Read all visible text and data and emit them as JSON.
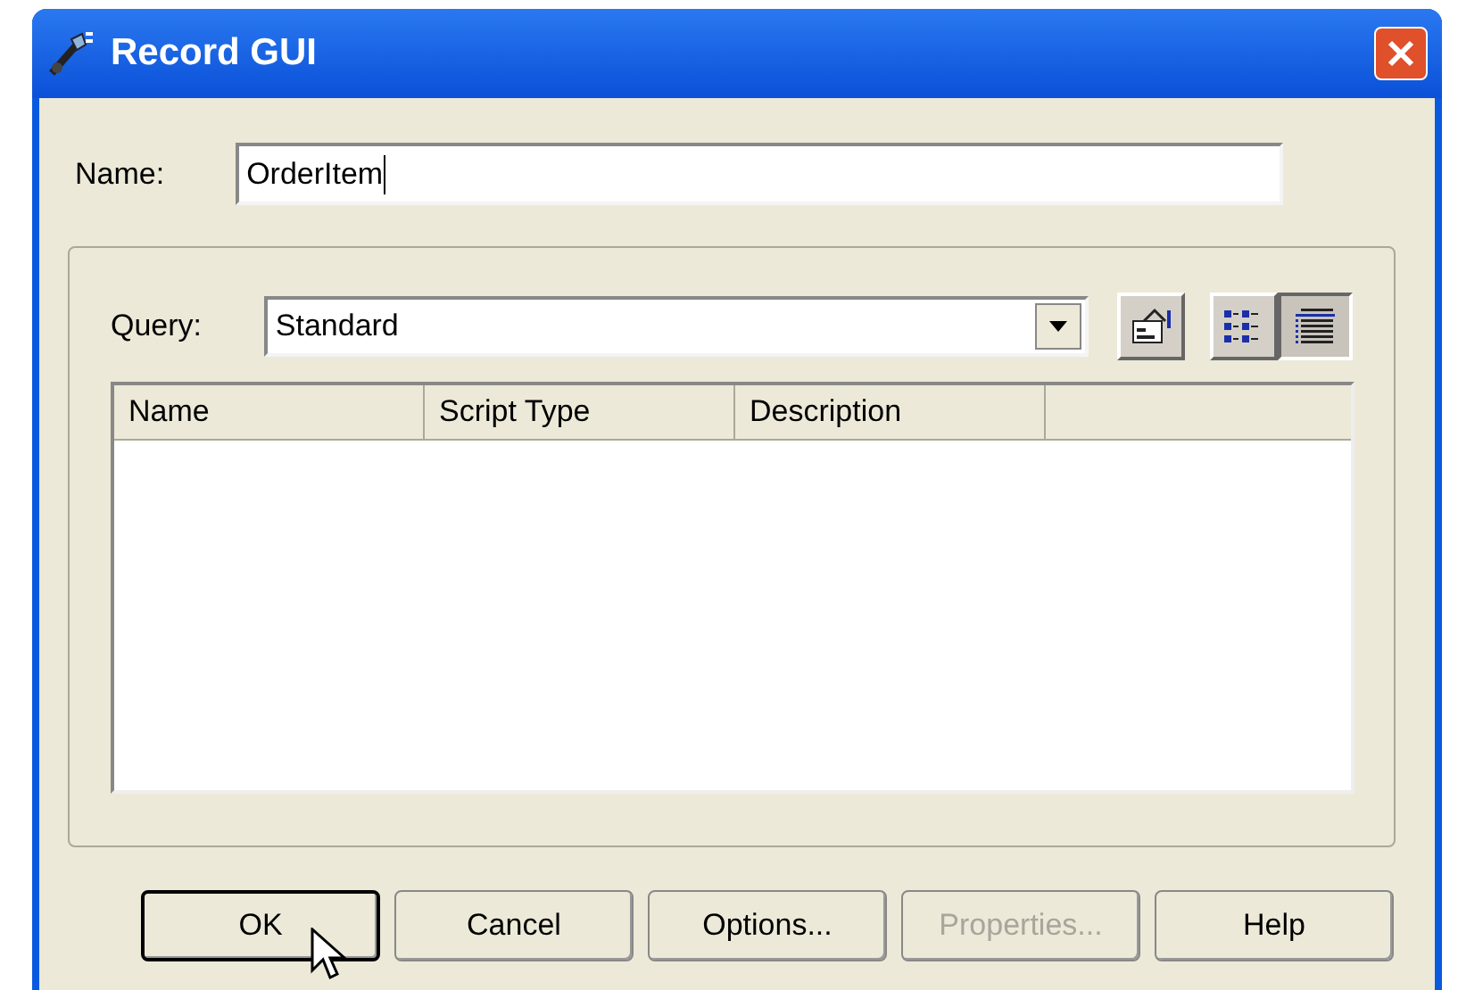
{
  "window": {
    "title": "Record GUI"
  },
  "name_field": {
    "label": "Name:",
    "value": "OrderItem"
  },
  "query": {
    "label": "Query:",
    "value": "Standard"
  },
  "view_buttons": [
    {
      "kind": "list",
      "selected": false
    },
    {
      "kind": "details",
      "selected": true
    }
  ],
  "table": {
    "columns": [
      "Name",
      "Script Type",
      "Description"
    ]
  },
  "buttons": [
    {
      "label": "OK",
      "default": true,
      "disabled": false
    },
    {
      "label": "Cancel",
      "default": false,
      "disabled": false
    },
    {
      "label": "Options...",
      "default": false,
      "disabled": false
    },
    {
      "label": "Properties...",
      "default": false,
      "disabled": true
    },
    {
      "label": "Help",
      "default": false,
      "disabled": false
    }
  ]
}
